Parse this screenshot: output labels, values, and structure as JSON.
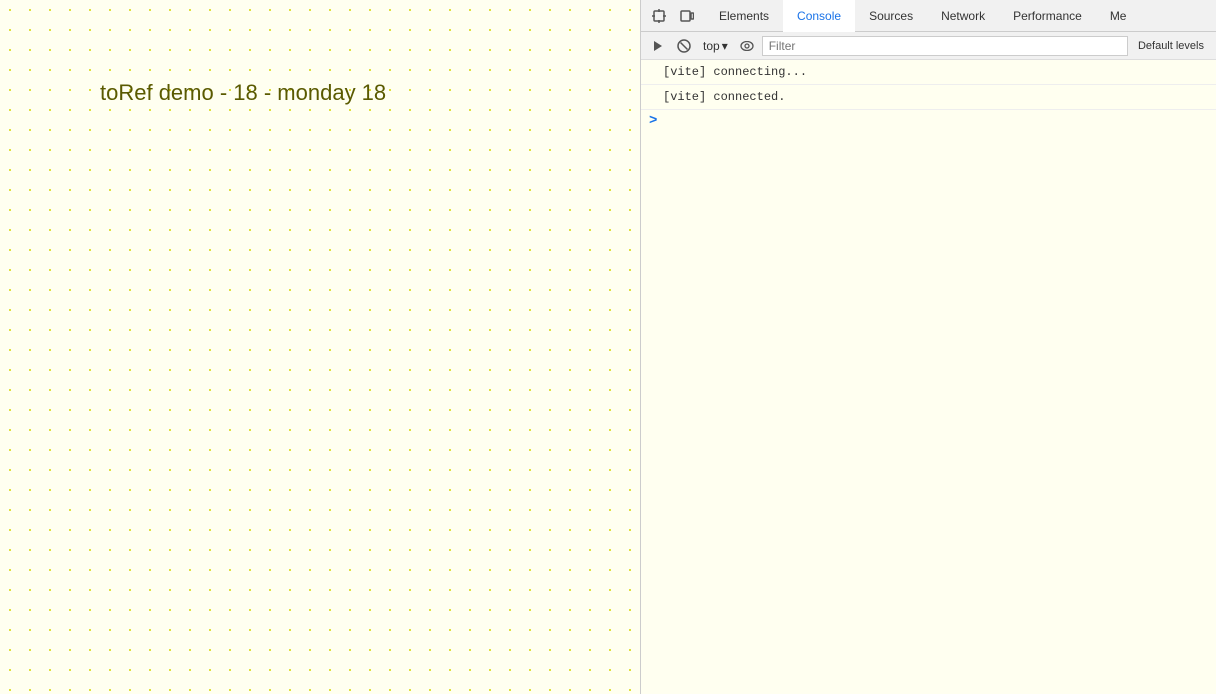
{
  "main_page": {
    "background_color": "#fffff0",
    "content_text": "toRef demo - 18 - monday 18"
  },
  "devtools": {
    "toolbar_icons": [
      {
        "name": "inspect-element",
        "symbol": "⬚"
      },
      {
        "name": "device-toolbar",
        "symbol": "▭"
      }
    ],
    "tabs": [
      {
        "label": "Elements",
        "active": false
      },
      {
        "label": "Console",
        "active": true
      },
      {
        "label": "Sources",
        "active": false
      },
      {
        "label": "Network",
        "active": false
      },
      {
        "label": "Performance",
        "active": false
      },
      {
        "label": "Me",
        "active": false
      }
    ],
    "console": {
      "toolbar": {
        "clear_label": "🚫",
        "context_label": "top",
        "eye_label": "👁",
        "filter_placeholder": "Filter",
        "default_levels_label": "Default levels"
      },
      "messages": [
        {
          "text": "[vite] connecting...",
          "type": "info"
        },
        {
          "text": "[vite] connected.",
          "type": "info"
        }
      ],
      "prompt_symbol": ">"
    }
  }
}
